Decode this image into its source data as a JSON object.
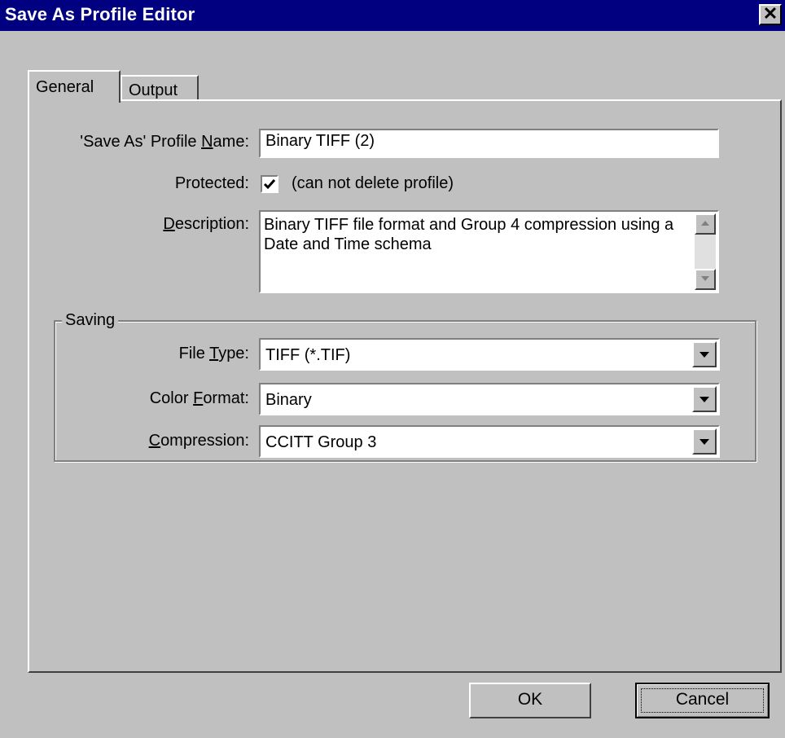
{
  "window": {
    "title": "Save As Profile Editor",
    "close_glyph": "✕"
  },
  "tabs": [
    {
      "label": "General",
      "active": true
    },
    {
      "label": "Output",
      "active": false
    }
  ],
  "form": {
    "profile_name_label_pre": "'Save As' Profile ",
    "profile_name_label_ul": "N",
    "profile_name_label_post": "ame:",
    "profile_name_value": "Binary TIFF (2)",
    "protected_label": "Protected:",
    "protected_checked": true,
    "protected_note": "(can not delete profile)",
    "description_label_ul": "D",
    "description_label_post": "escription:",
    "description_value": "Binary TIFF file format and Group 4 compression using a Date and Time schema"
  },
  "saving": {
    "group_label": "Saving",
    "file_type_label_pre": "File ",
    "file_type_label_ul": "T",
    "file_type_label_post": "ype:",
    "file_type_value": "TIFF (*.TIF)",
    "color_format_label_pre": "Color ",
    "color_format_label_ul": "F",
    "color_format_label_post": "ormat:",
    "color_format_value": "Binary",
    "compression_label_ul": "C",
    "compression_label_post": "ompression:",
    "compression_value": "CCITT Group 3"
  },
  "buttons": {
    "ok": "OK",
    "cancel": "Cancel"
  },
  "icons": {
    "close": "close-icon",
    "check": "checkmark-icon",
    "scroll_up": "triangle-up-icon",
    "scroll_down": "triangle-down-icon",
    "dropdown": "triangle-down-icon"
  }
}
